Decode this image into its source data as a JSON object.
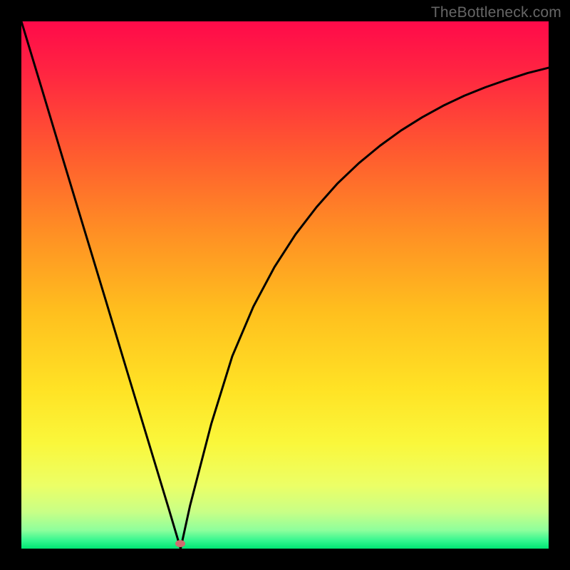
{
  "watermark": "TheBottleneck.com",
  "marker": {
    "x_frac": 0.302,
    "y_frac": 0.991,
    "color": "#cf6b6e"
  },
  "gradient_stops": [
    {
      "pos": 0.0,
      "color": "#ff0a4a"
    },
    {
      "pos": 0.1,
      "color": "#ff2641"
    },
    {
      "pos": 0.25,
      "color": "#ff5b2f"
    },
    {
      "pos": 0.4,
      "color": "#ff8f24"
    },
    {
      "pos": 0.55,
      "color": "#ffbf1e"
    },
    {
      "pos": 0.7,
      "color": "#ffe325"
    },
    {
      "pos": 0.8,
      "color": "#faf73b"
    },
    {
      "pos": 0.88,
      "color": "#ecff66"
    },
    {
      "pos": 0.93,
      "color": "#c9ff86"
    },
    {
      "pos": 0.965,
      "color": "#8eff9c"
    },
    {
      "pos": 0.985,
      "color": "#33f68f"
    },
    {
      "pos": 1.0,
      "color": "#00e573"
    }
  ],
  "chart_data": {
    "type": "line",
    "title": "",
    "xlabel": "",
    "ylabel": "",
    "xlim": [
      0,
      1
    ],
    "ylim": [
      0,
      1
    ],
    "series": [
      {
        "name": "bottleneck-curve",
        "x": [
          0.0,
          0.04,
          0.08,
          0.12,
          0.16,
          0.2,
          0.24,
          0.28,
          0.302,
          0.32,
          0.36,
          0.4,
          0.44,
          0.48,
          0.52,
          0.56,
          0.6,
          0.64,
          0.68,
          0.72,
          0.76,
          0.8,
          0.84,
          0.88,
          0.92,
          0.96,
          1.0
        ],
        "y": [
          1.0,
          0.868,
          0.735,
          0.603,
          0.471,
          0.338,
          0.206,
          0.074,
          0.0,
          0.082,
          0.236,
          0.365,
          0.459,
          0.534,
          0.596,
          0.648,
          0.693,
          0.731,
          0.764,
          0.793,
          0.818,
          0.84,
          0.859,
          0.875,
          0.889,
          0.902,
          0.912
        ]
      }
    ],
    "annotations": [
      {
        "type": "marker",
        "x": 0.302,
        "y": 0.0,
        "color": "#cf6b6e"
      }
    ]
  }
}
